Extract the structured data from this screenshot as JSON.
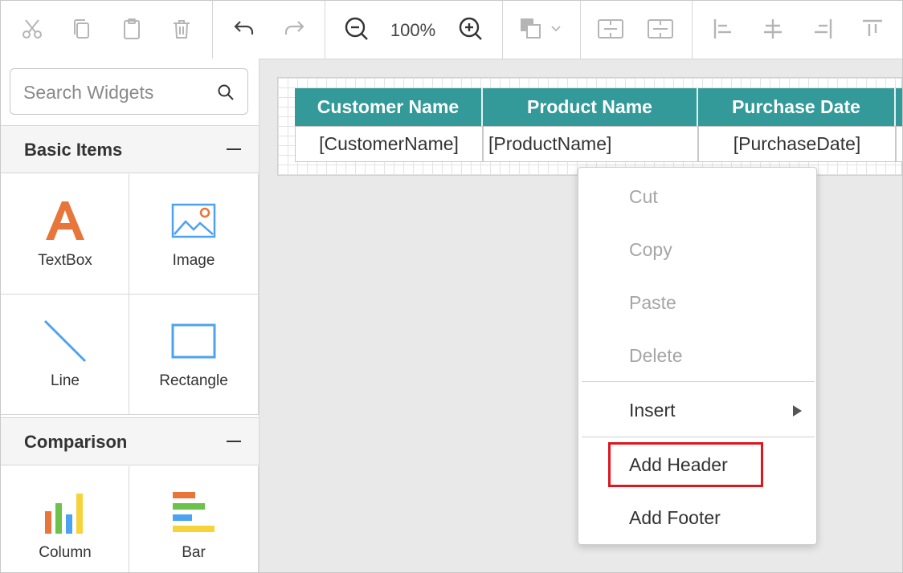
{
  "toolbar": {
    "zoom_level": "100%",
    "icons": [
      "cut-icon",
      "copy-icon",
      "paste-icon",
      "delete-icon",
      "undo-icon",
      "redo-icon",
      "zoom-out-icon",
      "zoom-in-icon",
      "fill-color-icon",
      "merge-cells-icon",
      "split-cells-icon",
      "align-left-icon",
      "align-center-icon",
      "align-right-icon",
      "align-top-icon"
    ]
  },
  "search": {
    "placeholder": "Search Widgets",
    "value": ""
  },
  "sections": {
    "basic": {
      "title": "Basic Items",
      "items": [
        {
          "label": "TextBox",
          "icon": "textbox-icon"
        },
        {
          "label": "Image",
          "icon": "image-icon"
        },
        {
          "label": "Line",
          "icon": "line-icon"
        },
        {
          "label": "Rectangle",
          "icon": "rectangle-icon"
        }
      ]
    },
    "comparison": {
      "title": "Comparison",
      "items": [
        {
          "label": "Column",
          "icon": "column-chart-icon"
        },
        {
          "label": "Bar",
          "icon": "bar-chart-icon"
        }
      ]
    }
  },
  "table": {
    "headers": [
      "Customer Name",
      "Product Name",
      "Purchase Date"
    ],
    "row": [
      "[CustomerName]",
      "[ProductName]",
      "[PurchaseDate]"
    ]
  },
  "context_menu": {
    "cut": "Cut",
    "copy": "Copy",
    "paste": "Paste",
    "delete": "Delete",
    "insert": "Insert",
    "add_header": "Add Header",
    "add_footer": "Add Footer"
  },
  "colors": {
    "table_header_bg": "#339999",
    "highlight": "#e0161e",
    "accent_orange": "#e8763a",
    "accent_blue": "#4da3f0"
  }
}
